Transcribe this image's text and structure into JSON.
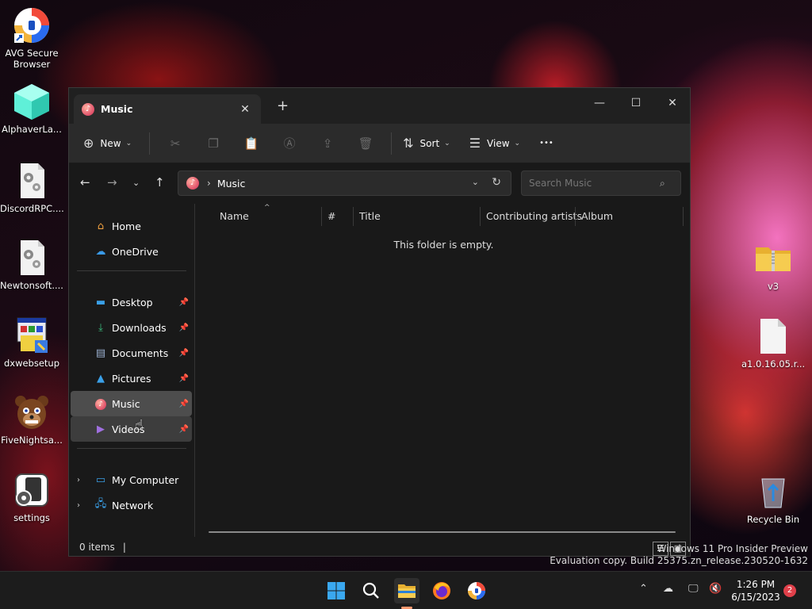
{
  "desktop": {
    "left_icons": [
      {
        "label": "AVG Secure Browser",
        "icon": "avg-browser-icon"
      },
      {
        "label": "AlphaverLa...",
        "icon": "cube-icon"
      },
      {
        "label": "DiscordRPC....",
        "icon": "settings-file-icon"
      },
      {
        "label": "Newtonsoft....",
        "icon": "settings-file-icon"
      },
      {
        "label": "dxwebsetup",
        "icon": "installer-icon"
      },
      {
        "label": "FiveNightsa...",
        "icon": "freddy-icon"
      },
      {
        "label": "settings",
        "icon": "settings-app-icon"
      }
    ],
    "right_icons": [
      {
        "label": "v3",
        "icon": "zip-folder-icon"
      },
      {
        "label": "a1.0.16.05.r...",
        "icon": "blank-file-icon"
      },
      {
        "label": "Recycle Bin",
        "icon": "recycle-bin-icon"
      }
    ],
    "watermark": {
      "line1": "Windows 11 Pro Insider Preview",
      "line2": "Evaluation copy. Build 25375.zn_release.230520-1632"
    }
  },
  "explorer": {
    "tab_title": "Music",
    "tab_close": "✕",
    "new_tab": "+",
    "window_controls": {
      "minimize": "—",
      "maximize": "☐",
      "close": "✕"
    },
    "toolbar": {
      "new_label": "New",
      "sort_label": "Sort",
      "view_label": "View",
      "more_label": "•••"
    },
    "address": {
      "path": "Music"
    },
    "search": {
      "placeholder": "Search Music"
    },
    "sidebar": {
      "top": [
        {
          "label": "Home",
          "icon": "home-icon"
        },
        {
          "label": "OneDrive",
          "icon": "cloud-icon"
        }
      ],
      "pinned": [
        {
          "label": "Desktop",
          "icon": "desktop-icon"
        },
        {
          "label": "Downloads",
          "icon": "download-icon"
        },
        {
          "label": "Documents",
          "icon": "document-icon"
        },
        {
          "label": "Pictures",
          "icon": "picture-icon"
        },
        {
          "label": "Music",
          "icon": "music-icon",
          "selected": true
        },
        {
          "label": "Videos",
          "icon": "video-icon",
          "hover": true
        }
      ],
      "bottom": [
        {
          "label": "My Computer",
          "icon": "computer-icon"
        },
        {
          "label": "Network",
          "icon": "network-icon"
        }
      ]
    },
    "columns": [
      "Name",
      "#",
      "Title",
      "Contributing artists",
      "Album"
    ],
    "empty_message": "This folder is empty.",
    "status": {
      "items": "0 items"
    }
  },
  "taskbar": {
    "apps": [
      "start-icon",
      "search-icon",
      "file-explorer-icon",
      "firefox-icon",
      "avg-browser-icon"
    ],
    "clock": {
      "time": "1:26 PM",
      "date": "6/15/2023"
    },
    "notifications": "2"
  },
  "colors": {
    "window_bg": "#191919",
    "toolbar_bg": "#2b2b2b",
    "selected_bg": "#4d4d4d",
    "accent_music": "#e0506a"
  }
}
